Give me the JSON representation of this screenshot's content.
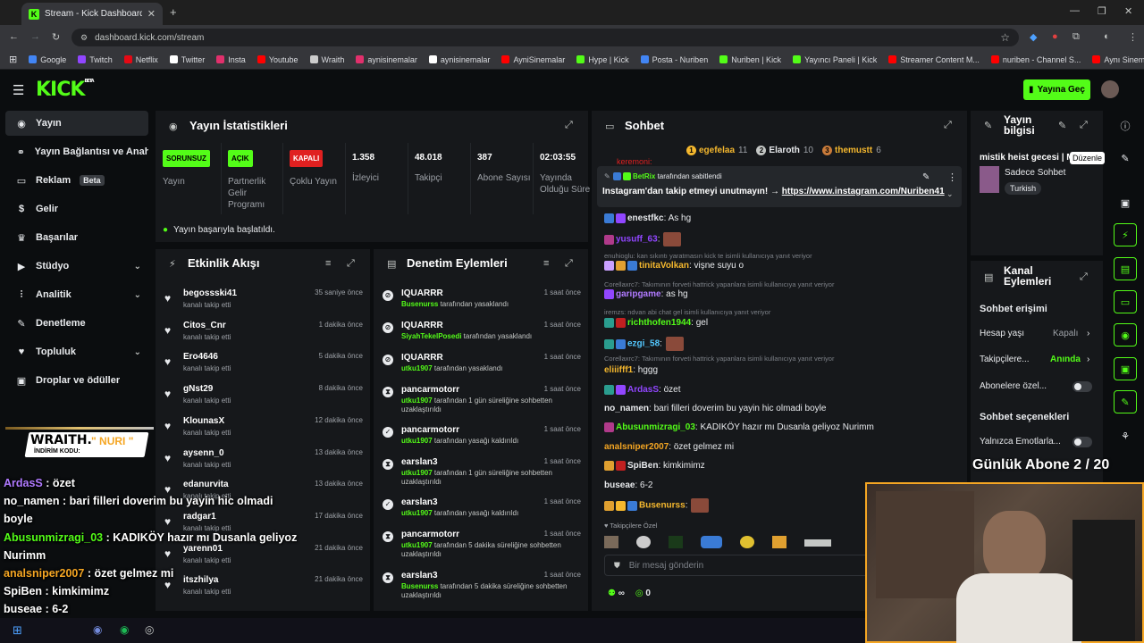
{
  "browser": {
    "tab_title": "Stream - Kick Dashboard",
    "url": "dashboard.kick.com/stream",
    "bookmarks": [
      {
        "label": "Google",
        "color": "#4285f4"
      },
      {
        "label": "Twitch",
        "color": "#9146ff"
      },
      {
        "label": "Netflix",
        "color": "#e50914"
      },
      {
        "label": "Twitter",
        "color": "#ffffff"
      },
      {
        "label": "Insta",
        "color": "#e1306c"
      },
      {
        "label": "Youtube",
        "color": "#ff0000"
      },
      {
        "label": "Wraith",
        "color": "#cccccc"
      },
      {
        "label": "aynisinemalar",
        "color": "#e1306c"
      },
      {
        "label": "aynisinemalar",
        "color": "#ffffff"
      },
      {
        "label": "AyniSinemalar",
        "color": "#ff0000"
      },
      {
        "label": "Hype | Kick",
        "color": "#53fc18"
      },
      {
        "label": "Posta - Nuriben",
        "color": "#4285f4"
      },
      {
        "label": "Nuriben | Kick",
        "color": "#53fc18"
      },
      {
        "label": "Yayıncı Paneli | Kick",
        "color": "#53fc18"
      },
      {
        "label": "Streamer Content M...",
        "color": "#ff0000"
      },
      {
        "label": "nuriben - Channel S...",
        "color": "#ff0000"
      },
      {
        "label": "Aynı Sinemalar - Ça...",
        "color": "#ff0000"
      }
    ]
  },
  "header": {
    "logo": "KICK",
    "logo_sup": "BETA",
    "go_live": "Yayına Geç"
  },
  "sidebar": {
    "items": [
      {
        "label": "Yayın",
        "icon": "broadcast-icon",
        "glyph": "◉"
      },
      {
        "label": "Yayın Bağlantısı ve Anahtar",
        "icon": "link-icon",
        "glyph": "⚭"
      },
      {
        "label": "Reklam",
        "icon": "ad-icon",
        "glyph": "▭",
        "badge": "Beta"
      },
      {
        "label": "Gelir",
        "icon": "dollar-icon",
        "glyph": "$"
      },
      {
        "label": "Başarılar",
        "icon": "trophy-icon",
        "glyph": "♛"
      },
      {
        "label": "Stüdyo",
        "icon": "studio-icon",
        "glyph": "▶"
      },
      {
        "label": "Analitik",
        "icon": "chart-icon",
        "glyph": "⫶"
      },
      {
        "label": "Denetleme",
        "icon": "wrench-icon",
        "glyph": "✎"
      },
      {
        "label": "Topluluk",
        "icon": "heart-icon",
        "glyph": "♥"
      },
      {
        "label": "Droplar ve ödüller",
        "icon": "gift-icon",
        "glyph": "▣"
      }
    ]
  },
  "stats": {
    "title": "Yayın İstatistikleri",
    "columns": [
      {
        "badge": "SORUNSUZ",
        "badge_color": "#53fc18",
        "label": "Yayın"
      },
      {
        "badge": "AÇIK",
        "badge_color": "#53fc18",
        "label": "Partnerlik Gelir Programı"
      },
      {
        "badge": "KAPALI",
        "badge_color": "#e02020",
        "label": "Çoklu Yayın"
      },
      {
        "value": "1.358",
        "label": "İzleyici"
      },
      {
        "value": "48.018",
        "label": "Takipçi"
      },
      {
        "value": "387",
        "label": "Abone Sayısı"
      },
      {
        "value": "02:03:55",
        "label": "Yayında Olduğu Süre"
      }
    ],
    "success_message": "Yayın başarıyla başlatıldı."
  },
  "activity": {
    "title": "Etkinlik Akışı",
    "events": [
      {
        "name": "begossski41",
        "sub": "kanalı takip etti",
        "time": "35 saniye önce"
      },
      {
        "name": "Citos_Cnr",
        "sub": "kanalı takip etti",
        "time": "1 dakika önce"
      },
      {
        "name": "Ero4646",
        "sub": "kanalı takip etti",
        "time": "5 dakika önce"
      },
      {
        "name": "gNst29",
        "sub": "kanalı takip etti",
        "time": "8 dakika önce"
      },
      {
        "name": "KlounasX",
        "sub": "kanalı takip etti",
        "time": "12 dakika önce"
      },
      {
        "name": "aysenn_0",
        "sub": "kanalı takip etti",
        "time": "13 dakika önce"
      },
      {
        "name": "edanurvita",
        "sub": "kanalı takip etti",
        "time": "13 dakika önce"
      },
      {
        "name": "radgar1",
        "sub": "kanalı takip etti",
        "time": "17 dakika önce"
      },
      {
        "name": "yarenn01",
        "sub": "kanalı takip etti",
        "time": "21 dakika önce"
      },
      {
        "name": "itszhilya",
        "sub": "kanalı takip etti",
        "time": "21 dakika önce"
      }
    ]
  },
  "moderation": {
    "title": "Denetim Eylemleri",
    "actions": [
      {
        "icon": "ban",
        "name": "IQUARRR",
        "actor": "Busenurss",
        "text": " tarafından yasaklandı",
        "time": "1 saat önce"
      },
      {
        "icon": "ban",
        "name": "IQUARRR",
        "actor": "SiyahTekelPosedi",
        "text": " tarafından yasaklandı",
        "time": "1 saat önce"
      },
      {
        "icon": "ban",
        "name": "IQUARRR",
        "actor": "utku1907",
        "text": " tarafından yasaklandı",
        "time": "1 saat önce"
      },
      {
        "icon": "timer",
        "name": "pancarmotorr",
        "actor": "utku1907",
        "text": " tarafından 1 gün süreliğine sohbetten uzaklaştırıldı",
        "time": "1 saat önce"
      },
      {
        "icon": "check",
        "name": "pancarmotorr",
        "actor": "utku1907",
        "text": " tarafından yasağı kaldırıldı",
        "time": "1 saat önce"
      },
      {
        "icon": "timer",
        "name": "earslan3",
        "actor": "utku1907",
        "text": " tarafından 1 gün süreliğine sohbetten uzaklaştırıldı",
        "time": "1 saat önce"
      },
      {
        "icon": "check",
        "name": "earslan3",
        "actor": "utku1907",
        "text": " tarafından yasağı kaldırıldı",
        "time": "1 saat önce"
      },
      {
        "icon": "timer",
        "name": "pancarmotorr",
        "actor": "utku1907",
        "text": " tarafından 5 dakika süreliğine sohbetten uzaklaştırıldı",
        "time": "1 saat önce"
      },
      {
        "icon": "timer",
        "name": "earslan3",
        "actor": "Busenurss",
        "text": " tarafından 5 dakika süreliğine sohbetten uzaklaştırıldı",
        "time": "1 saat önce"
      }
    ]
  },
  "chat": {
    "title": "Sohbet",
    "top_gifters": [
      {
        "rank": "1",
        "name": "egefelaa",
        "count": "11",
        "color": "#f5b82e"
      },
      {
        "rank": "2",
        "name": "Elaroth",
        "count": "10",
        "color": "#c4c7c5"
      },
      {
        "rank": "3",
        "name": "themustt",
        "count": "6",
        "color": "#c97b3a"
      }
    ],
    "partial_top": "keremoni:",
    "pinned": {
      "by": "BetRix",
      "by_suffix": " tarafından sabitlendi",
      "text": "Instagram'dan takip etmeyi unutmayın! → ",
      "link": "https://www.instagram.com/Nuriben41"
    },
    "messages": [
      {
        "kind": "msg",
        "user": "enestfkc",
        "color": "#e8eaed",
        "text": ": As hg",
        "badges": [
          "#3a7bd5",
          "#9146ff"
        ]
      },
      {
        "kind": "msg",
        "user": "yusuff_63",
        "color": "#9146ff",
        "text": ":",
        "badges": [
          "#b03a8a"
        ],
        "emote": true
      },
      {
        "kind": "reply",
        "text": "enuhioglu: kan sıkıntı yaratmasın kick te isimli kullanıcıya yanıt veriyor"
      },
      {
        "kind": "msg",
        "user": "tinitaVolkan",
        "color": "#f5b82e",
        "text": ": vişne suyu o",
        "badges": [
          "#c9a0ff",
          "#e0a030",
          "#3a7bd5"
        ]
      },
      {
        "kind": "reply",
        "text": "Corellaxrc7: Takımının forveti hattrick yapanlara isimli kullanıcıya yanıt veriyor"
      },
      {
        "kind": "msg",
        "user": "garipgame",
        "color": "#b07aff",
        "text": ": as hg",
        "badges": [
          "#9146ff"
        ]
      },
      {
        "kind": "reply",
        "text": "iremzs: ndvan abi chat gel isimli kullanıcıya yanıt veriyor"
      },
      {
        "kind": "msg",
        "user": "richthofen1944",
        "color": "#53fc18",
        "text": ": gel",
        "badges": [
          "#2a9d8f",
          "#c02020"
        ]
      },
      {
        "kind": "msg",
        "user": "ezgi_58",
        "color": "#53c8ff",
        "text": ":",
        "badges": [
          "#2a9d8f",
          "#3a7bd5"
        ],
        "emote": true
      },
      {
        "kind": "reply",
        "text": "Corellaxrc7: Takımının forveti hattrick yapanlara isimli kullanıcıya yanıt veriyor"
      },
      {
        "kind": "msg",
        "user": "eliiifff1",
        "color": "#f5b82e",
        "text": ": hggg",
        "badges": []
      },
      {
        "kind": "msg",
        "user": "ArdasS",
        "color": "#9146ff",
        "text": ": özet",
        "badges": [
          "#2a9d8f",
          "#9146ff"
        ]
      },
      {
        "kind": "msg",
        "user": "no_namen",
        "color": "#e8eaed",
        "text": ": bari filleri doverim bu yayin hic olmadi boyle",
        "badges": []
      },
      {
        "kind": "msg",
        "user": "Abusunmizragi_03",
        "color": "#53fc18",
        "text": ": KADIKÖY hazır mı Dusanla geliyoz Nurimm",
        "badges": [
          "#b03a8a"
        ]
      },
      {
        "kind": "msg",
        "user": "analsniper2007",
        "color": "#f5a623",
        "text": ": özet gelmez mi",
        "badges": []
      },
      {
        "kind": "msg",
        "user": "SpiBen",
        "color": "#e8eaed",
        "text": ": kimkimimz",
        "badges": [
          "#e0a030",
          "#c02020"
        ]
      },
      {
        "kind": "msg",
        "user": "buseae",
        "color": "#e8eaed",
        "text": ": 6-2",
        "badges": []
      },
      {
        "kind": "msg",
        "user": "Busenurss",
        "color": "#f5b82e",
        "text": ":",
        "badges": [
          "#e0a030",
          "#f5b82e",
          "#3a7bd5"
        ],
        "emote": true
      }
    ],
    "emote_bar_label": "Takipçilere Özel",
    "input_placeholder": "Bir mesaj gönderin",
    "infinity": "∞",
    "points": "0"
  },
  "stream_info": {
    "title": "Yayın bilgisi",
    "stream_title": "mistik heist gecesi | M",
    "tooltip": "Düzenle",
    "category": "Sadece Sohbet",
    "language": "Turkish"
  },
  "channel_actions": {
    "title": "Kanal Eylemleri",
    "chat_access": "Sohbet erişimi",
    "age": "Hesap yaşı",
    "age_value": "Kapalı",
    "followers": "Takipçilere...",
    "followers_value": "Anında",
    "subs_only": "Abonelere özel...",
    "chat_options": "Sohbet seçenekleri",
    "emotes_only": "Yalnızca Emotlarla..."
  },
  "overlay": {
    "sponsor_name": "WRAITH.",
    "sponsor_code": "\" NURI \"",
    "sponsor_sub": "İNDİRİM KODU:",
    "daily_subs": "Günlük Abone 2 / 20",
    "chat": [
      {
        "user": "ArdasS",
        "color": "#b07aff",
        "text": " : özet"
      },
      {
        "user": "no_namen",
        "color": "#ffffff",
        "text": " : bari filleri doverim bu yayin hic olmadi"
      },
      {
        "user": "",
        "color": "#ffffff",
        "text": "boyle"
      },
      {
        "user": "Abusunmizragi_03",
        "color": "#53fc18",
        "text": " : KADIKÖY hazır mı Dusanla geliyoz"
      },
      {
        "user": "",
        "color": "#ffffff",
        "text": "Nurimm"
      },
      {
        "user": "analsniper2007",
        "color": "#f5a623",
        "text": " : özet gelmez mi"
      },
      {
        "user": "SpiBen",
        "color": "#ffffff",
        "text": " : kimkimimz"
      },
      {
        "user": "buseae",
        "color": "#ffffff",
        "text": " : 6-2"
      }
    ]
  },
  "colors": {
    "accent": "#53fc18",
    "panel": "#16181b",
    "bg": "#0b0d0f"
  }
}
